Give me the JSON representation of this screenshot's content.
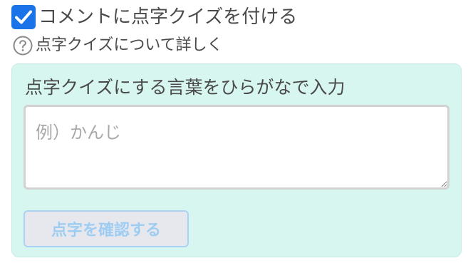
{
  "quiz_toggle": {
    "checked": true,
    "label": "コメントに点字クイズを付ける",
    "checkbox_color": "#1a73e8"
  },
  "help": {
    "icon": "question-circle-icon",
    "label": "点字クイズについて詳しく"
  },
  "panel": {
    "background": "#d6f6ef",
    "title": "点字クイズにする言葉をひらがなで入力",
    "input": {
      "placeholder": "例）かんじ",
      "value": ""
    },
    "confirm_button": {
      "label": "点字を確認する",
      "disabled": true
    }
  }
}
